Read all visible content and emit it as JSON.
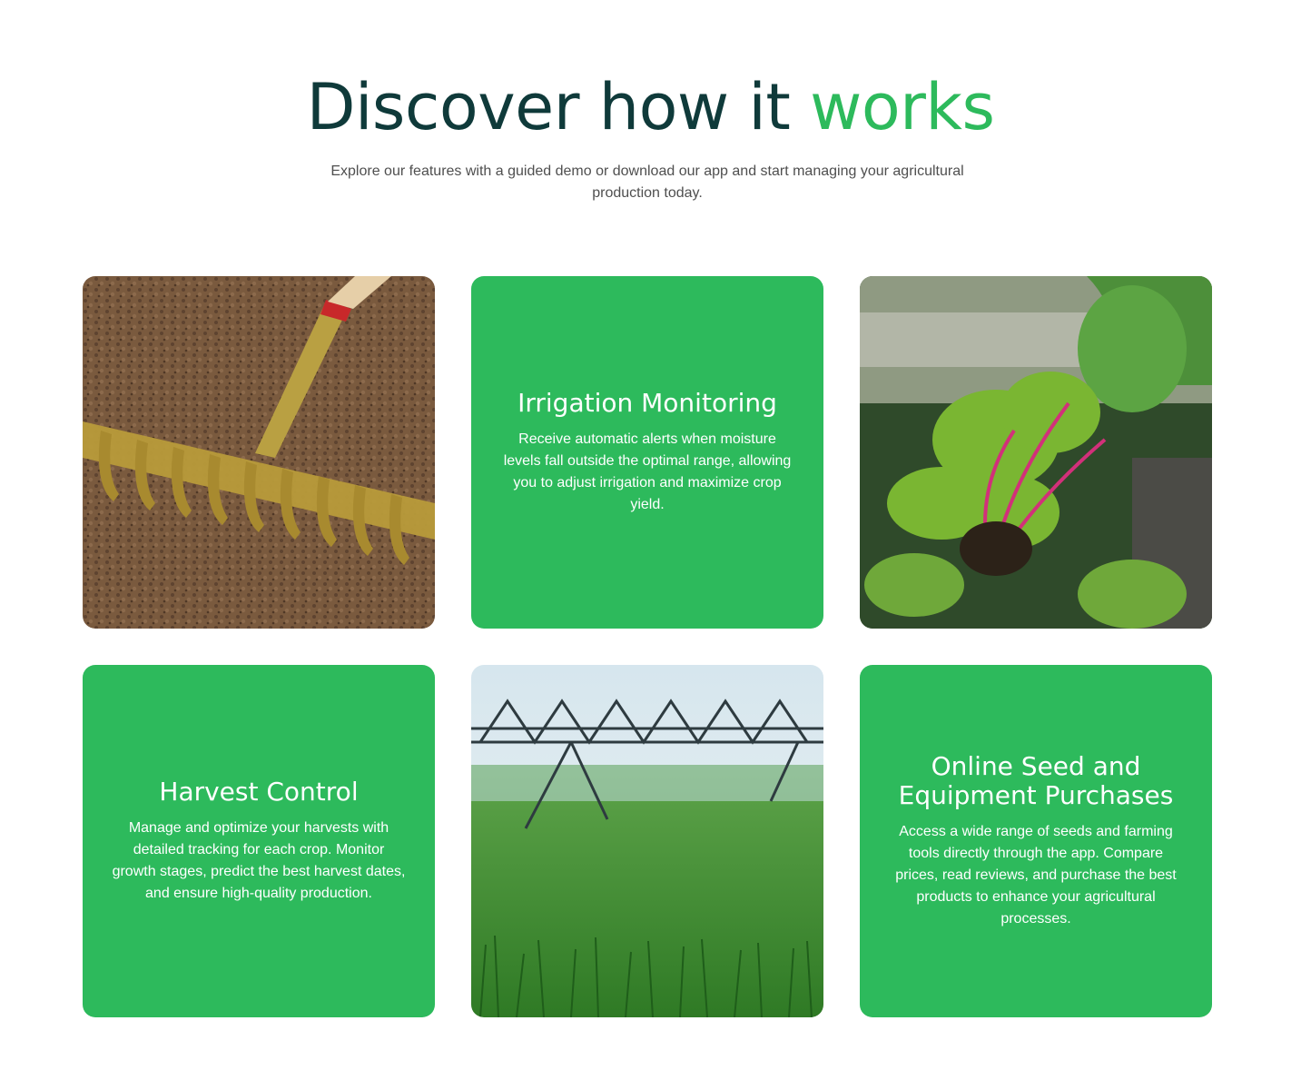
{
  "header": {
    "title_main": "Discover how it ",
    "title_accent": "works",
    "subtitle": "Explore our features with a guided demo or download our app and start managing your agricultural production today."
  },
  "cards": [
    {
      "type": "image",
      "image": "rake-on-soil-photo"
    },
    {
      "type": "text",
      "title": "Irrigation Monitoring",
      "body": "Receive automatic alerts when moisture levels fall outside the optimal range, allowing you to adjust irrigation and maximize crop yield."
    },
    {
      "type": "image",
      "image": "harvesting-chard-photo"
    },
    {
      "type": "text",
      "title": "Harvest Control",
      "body": "Manage and optimize your harvests with detailed tracking for each crop. Monitor growth stages, predict the best harvest dates, and ensure high-quality production."
    },
    {
      "type": "image",
      "image": "irrigation-sprinkler-field-photo"
    },
    {
      "type": "text",
      "title": "Online Seed and Equipment Purchases",
      "body": "Access a wide range of seeds and farming tools directly through the app. Compare prices, read reviews, and purchase the best products to enhance your agricultural processes."
    }
  ],
  "colors": {
    "accent": "#2dba5c",
    "heading": "#0f3a3a",
    "card_bg": "#2dba5c"
  }
}
